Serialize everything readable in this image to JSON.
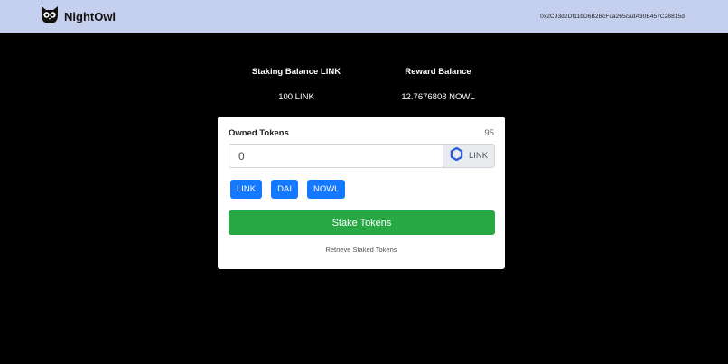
{
  "navbar": {
    "brand": "NightOwl",
    "account": "0x2C93d2Df11bD6B2BcFca265cadA30B457C28815d"
  },
  "balances": {
    "staking_label": "Staking Balance LINK",
    "staking_value": "100 LINK",
    "reward_label": "Reward Balance",
    "reward_value": "12.7676808 NOWL"
  },
  "form": {
    "owned_label": "Owned Tokens",
    "owned_count": "95",
    "amount_placeholder": "0",
    "selected_token": "LINK",
    "token_buttons": [
      "LINK",
      "DAI",
      "NOWL"
    ],
    "stake_label": "Stake Tokens",
    "retrieve_label": "Retrieve Staked Tokens"
  },
  "colors": {
    "navbar_bg": "#c5d0ef",
    "page_bg": "#000000",
    "primary": "#1479ff",
    "success": "#28a745",
    "link_token_blue": "#2a5ada"
  },
  "icons": {
    "brand_logo": "owl-logo-icon",
    "token_icon": "chainlink-hexagon-icon"
  }
}
